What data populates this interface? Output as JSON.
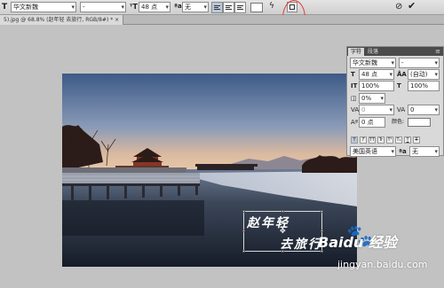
{
  "options_bar": {
    "font_family": "华文新魏",
    "font_style": "-",
    "font_size": "48 点",
    "anti_alias": "无",
    "cancel_icon": "cancel-icon",
    "commit_icon": "checkmark-icon"
  },
  "document_tab": {
    "label": "5).jpg @ 68.8% (赵年轻        去旅行, RGB/8#) *"
  },
  "canvas_text": {
    "line1": "赵年轻",
    "line2": "去旅行"
  },
  "character_panel": {
    "tab_character": "字符",
    "tab_paragraph": "段落",
    "font_family": "华文新魏",
    "font_style": "-",
    "font_size": "48 点",
    "leading": "(自动)",
    "vertical_scale": "100%",
    "horizontal_scale": "100%",
    "tsume": "0%",
    "kerning": "0",
    "tracking": "0",
    "baseline_shift": "0 点",
    "color_label": "颜色:",
    "color": "#ffffff",
    "language": "美国英语",
    "anti_alias": "无",
    "style_buttons": [
      "T",
      "T",
      "TT",
      "Tr",
      "T¹",
      "T₁",
      "T",
      "T"
    ]
  },
  "watermark": {
    "brand": "Baidu 经验",
    "url": "jingyan.baidu.com"
  },
  "annotation_color": "#e23b3b"
}
